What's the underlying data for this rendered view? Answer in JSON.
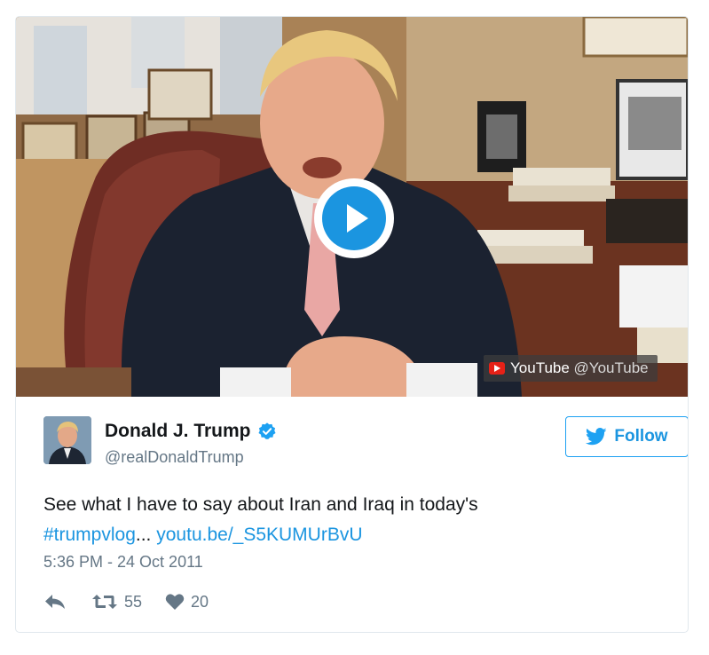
{
  "video": {
    "play_label": "Play video",
    "watermark_brand": "YouTube",
    "watermark_handle": "@YouTube"
  },
  "author": {
    "name": "Donald J. Trump",
    "handle": "@realDonaldTrump",
    "verified_icon": "verified-badge-icon"
  },
  "follow_button": {
    "label": "Follow",
    "icon": "bird-icon"
  },
  "tweet": {
    "text_plain": "See what I have to say about Iran and Iraq in today's",
    "hashtag": "#trumpvlog",
    "ellipsis": "...",
    "link": "youtu.be/_S5KUMUrBvU",
    "timestamp": "5:36 PM - 24 Oct 2011"
  },
  "actions": {
    "reply_icon": "reply-icon",
    "retweet_icon": "retweet-icon",
    "retweet_count": "55",
    "like_icon": "heart-icon",
    "like_count": "20"
  },
  "colors": {
    "accent": "#1b95e0",
    "secondary_text": "#657786",
    "youtube_red": "#e62117"
  }
}
